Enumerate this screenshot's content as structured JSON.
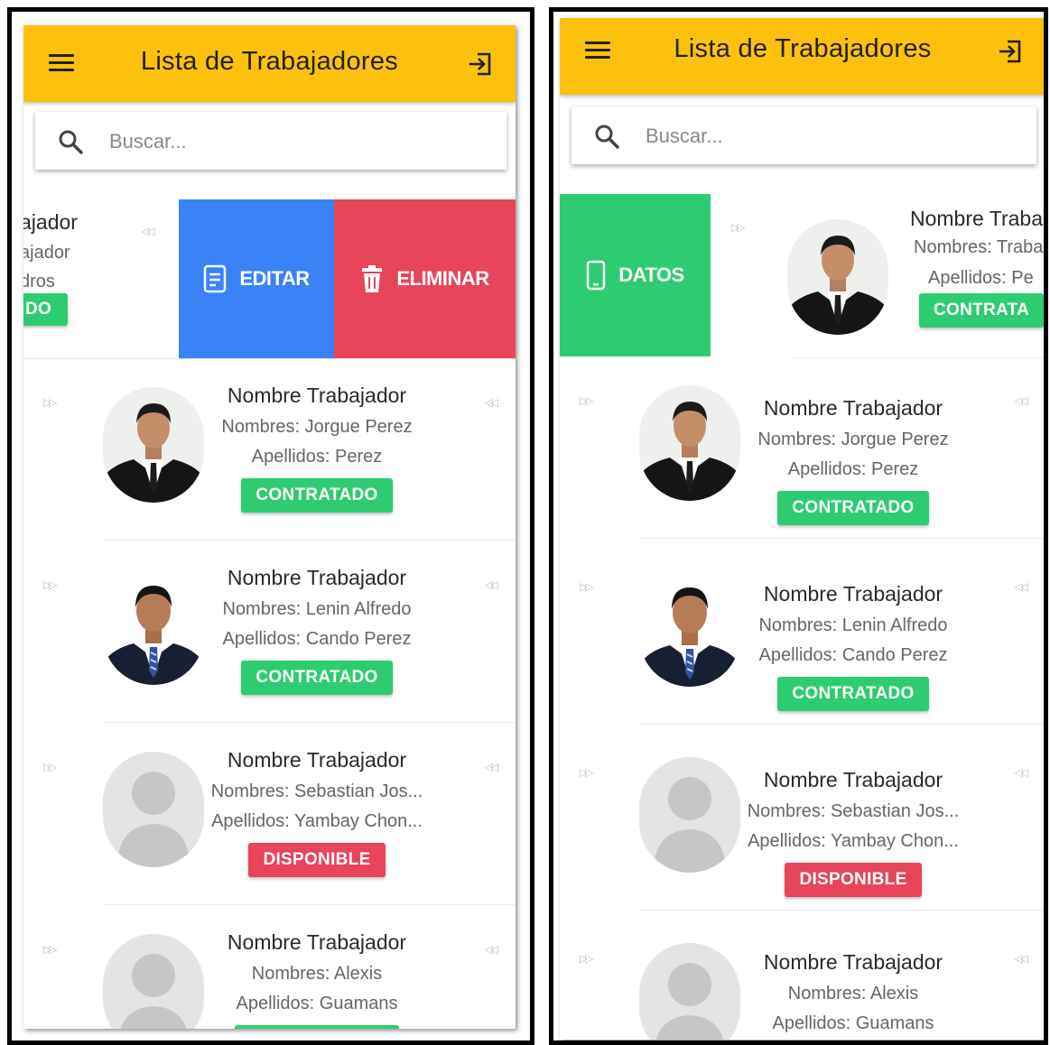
{
  "app": {
    "title": "Lista de Trabajadores",
    "search_placeholder": "Buscar..."
  },
  "colors": {
    "header": "#fcc10c",
    "contratado": "#2ecc71",
    "disponible": "#e8445a",
    "editar": "#3b82f6",
    "eliminar": "#e8445a",
    "datos": "#2ecc71"
  },
  "icons": {
    "menu": "hamburger-icon",
    "logout": "logout-icon",
    "search": "search-icon",
    "edit": "document-edit-icon",
    "delete": "trash-icon",
    "datos": "phone-icon",
    "swipe": "double-arrow-icon"
  },
  "left_screen": {
    "swiped_row": {
      "partial_title": "ajador",
      "partial_nombres": "ajador",
      "partial_apellidos": "dros",
      "partial_badge": "DO",
      "actions": [
        {
          "label": "EDITAR",
          "icon": "document-edit-icon"
        },
        {
          "label": "ELIMINAR",
          "icon": "trash-icon"
        }
      ]
    },
    "rows": [
      {
        "title": "Nombre Trabajador",
        "nombres": "Nombres: Jorgue Perez",
        "apellidos": "Apellidos: Perez",
        "status": "CONTRATADO",
        "avatar": "photo-man-suit"
      },
      {
        "title": "Nombre Trabajador",
        "nombres": "Nombres: Lenin Alfredo",
        "apellidos": "Apellidos: Cando Perez",
        "status": "CONTRATADO",
        "avatar": "photo-man-suit-blue-tie"
      },
      {
        "title": "Nombre Trabajador",
        "nombres": "Nombres: Sebastian Jos...",
        "apellidos": "Apellidos: Yambay Chon...",
        "status": "DISPONIBLE",
        "avatar": "placeholder-user"
      },
      {
        "title": "Nombre Trabajador",
        "nombres": "Nombres: Alexis",
        "apellidos": "Apellidos: Guamans",
        "status": "",
        "avatar": "placeholder-user"
      }
    ]
  },
  "right_screen": {
    "swiped_row": {
      "action": {
        "label": "DATOS",
        "icon": "phone-icon"
      },
      "partial_title": "Nombre Traba",
      "partial_nombres": "Nombres: Traba",
      "partial_apellidos": "Apellidos: Pe",
      "partial_badge": "CONTRATA"
    },
    "rows": [
      {
        "title": "Nombre Trabajador",
        "nombres": "Nombres: Jorgue Perez",
        "apellidos": "Apellidos: Perez",
        "status": "CONTRATADO",
        "avatar": "photo-man-suit"
      },
      {
        "title": "Nombre Trabajador",
        "nombres": "Nombres: Lenin Alfredo",
        "apellidos": "Apellidos: Cando Perez",
        "status": "CONTRATADO",
        "avatar": "photo-man-suit-blue-tie"
      },
      {
        "title": "Nombre Trabajador",
        "nombres": "Nombres: Sebastian Jos...",
        "apellidos": "Apellidos: Yambay Chon...",
        "status": "DISPONIBLE",
        "avatar": "placeholder-user"
      },
      {
        "title": "Nombre Trabajador",
        "nombres": "Nombres: Alexis",
        "apellidos": "Apellidos: Guamans",
        "status": "",
        "avatar": "placeholder-user"
      }
    ]
  }
}
